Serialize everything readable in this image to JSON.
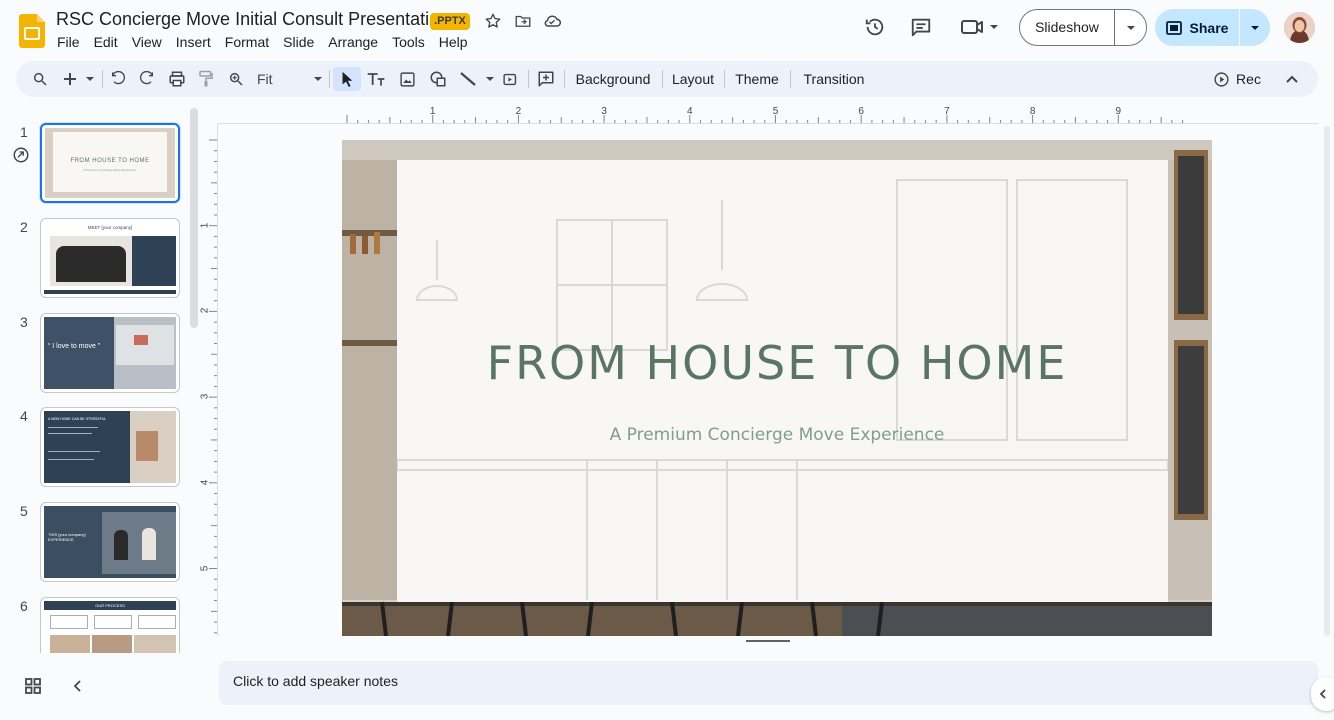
{
  "header": {
    "title": "RSC Concierge Move Initial Consult Presentation",
    "badge": ".PPTX",
    "icons": [
      "star-icon",
      "move-to-folder-icon",
      "cloud-status-icon",
      "history-icon",
      "comments-icon",
      "meet-icon"
    ]
  },
  "menu": [
    "File",
    "Edit",
    "View",
    "Insert",
    "Format",
    "Slide",
    "Arrange",
    "Tools",
    "Help"
  ],
  "actions": {
    "slideshow_label": "Slideshow",
    "share_label": "Share"
  },
  "toolbar": {
    "zoom_value": "Fit",
    "background_label": "Background",
    "layout_label": "Layout",
    "theme_label": "Theme",
    "transition_label": "Transition",
    "rec_label": "Rec"
  },
  "ruler": {
    "h_labels": [
      "1",
      "2",
      "3",
      "4",
      "5",
      "6",
      "7",
      "8",
      "9"
    ],
    "v_labels": [
      "1",
      "2",
      "3",
      "4",
      "5"
    ]
  },
  "filmstrip": {
    "slides": [
      {
        "num": "1",
        "text": "FROM HOUSE TO HOME",
        "sub": "A Premium Concierge Move Experience"
      },
      {
        "num": "2",
        "text": "MEET [your company]",
        "sub": ""
      },
      {
        "num": "3",
        "text": "“ I love to move ”",
        "sub": ""
      },
      {
        "num": "4",
        "text": "A NEW HOME CAN BE STRESSFUL",
        "sub": ""
      },
      {
        "num": "5",
        "text": "THIS [your company] EXPERIENCE",
        "sub": ""
      },
      {
        "num": "6",
        "text": "OUR PROCESS",
        "sub": ""
      }
    ]
  },
  "slide": {
    "title": "FROM HOUSE TO HOME",
    "subtitle": "A Premium Concierge Move Experience"
  },
  "notes": {
    "placeholder": "Click to add speaker notes"
  },
  "colors": {
    "accent_blue": "#1a73e8",
    "share_bg": "#c2e7ff",
    "badge": "#f4b400",
    "slide_title": "#5a7566",
    "slide_subtitle": "#7ea08a"
  }
}
